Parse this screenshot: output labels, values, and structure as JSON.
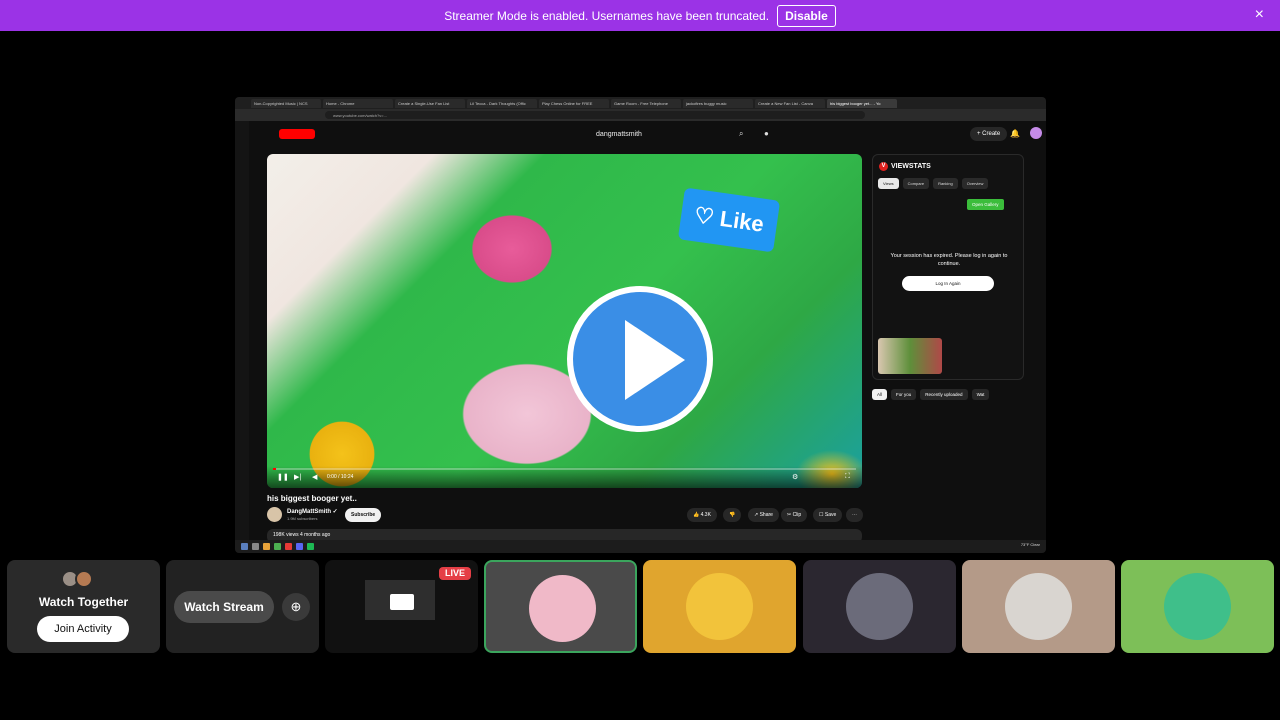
{
  "banner": {
    "message": "Streamer Mode is enabled. Usernames have been truncated.",
    "disable_label": "Disable",
    "close_icon": "×"
  },
  "browser": {
    "tabs": [
      "Non-Copyrighted Music | NCS",
      "Home - Chrome",
      "Create a Single-Use Fan List",
      "Lil Tecca - Dark Thoughts (Offic",
      "Play Chess Online for FREE",
      "Game Room - Free Telephone",
      "jackofires buggy music",
      "Create a New Fan List - Canva",
      "his biggest booger yet... - Yo"
    ],
    "url": "www.youtube.com/watch?v=..."
  },
  "youtube": {
    "search_query": "dangmattsmith",
    "create_label": "+ Create",
    "video": {
      "like_sign": "♡ Like",
      "time": "0:00 / 10:24",
      "progress": 0.005,
      "title": "his biggest booger yet..",
      "channel": "DangMattSmith ✓",
      "subs": "1.9M subscribers",
      "subscribe": "Subscribe",
      "likes": "👍 4.3K",
      "share": "↗ Share",
      "clip": "✂ Clip",
      "save": "☐ Save",
      "views": "198K views  4 months ago"
    },
    "viewstats": {
      "brand": "VIEWSTATS",
      "logo": "V",
      "tabs": [
        "Views",
        "Compare",
        "Ranking",
        "Overview"
      ],
      "gallery": "Open Gallery",
      "expired": "Your session has expired. Please log in again to continue.",
      "login": "Log In Again"
    },
    "chips": [
      "All",
      "For you",
      "Recently uploaded",
      "Wat"
    ]
  },
  "taskbar": {
    "tray": "73°F Clear"
  },
  "tiles": {
    "watch_together": "Watch Together",
    "join_activity": "Join Activity",
    "watch_stream": "Watch Stream",
    "live": "LIVE"
  },
  "colors": {
    "banner": "#9b33e6",
    "live": "#e53e46",
    "speaking": "#3ba55d"
  }
}
